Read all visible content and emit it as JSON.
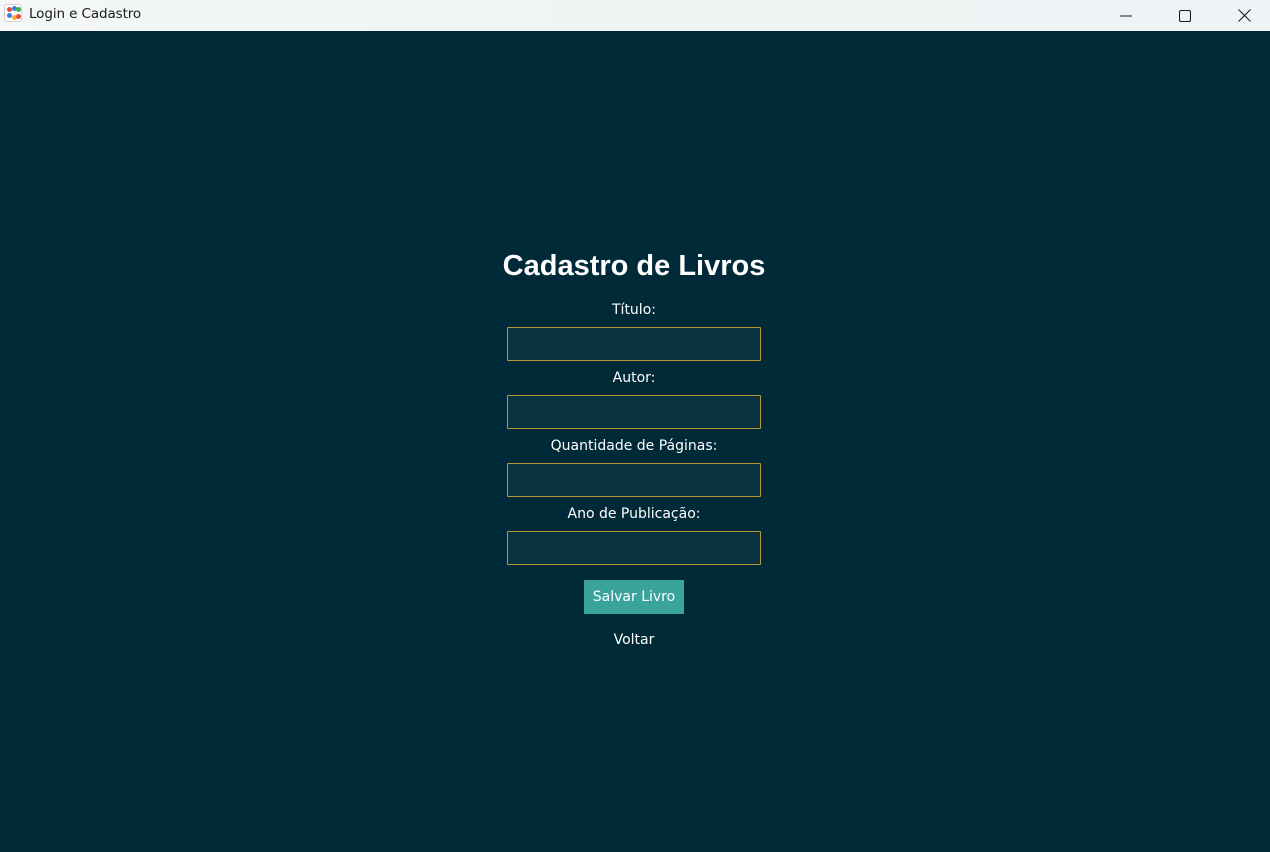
{
  "window": {
    "title": "Login e Cadastro",
    "controls": {
      "minimize_icon": "minimize-icon",
      "maximize_icon": "maximize-icon",
      "close_icon": "close-icon"
    }
  },
  "colors": {
    "background": "#002a37",
    "input_background": "#093340",
    "input_border": "#b59a3a",
    "button_background": "#3aa39c",
    "text": "#ffffff"
  },
  "form": {
    "title": "Cadastro de Livros",
    "fields": [
      {
        "label": "Título:",
        "value": "",
        "placeholder": ""
      },
      {
        "label": "Autor:",
        "value": "",
        "placeholder": ""
      },
      {
        "label": "Quantidade de Páginas:",
        "value": "",
        "placeholder": ""
      },
      {
        "label": "Ano de Publicação:",
        "value": "",
        "placeholder": ""
      }
    ],
    "save_label": "Salvar Livro",
    "back_label": "Voltar"
  }
}
